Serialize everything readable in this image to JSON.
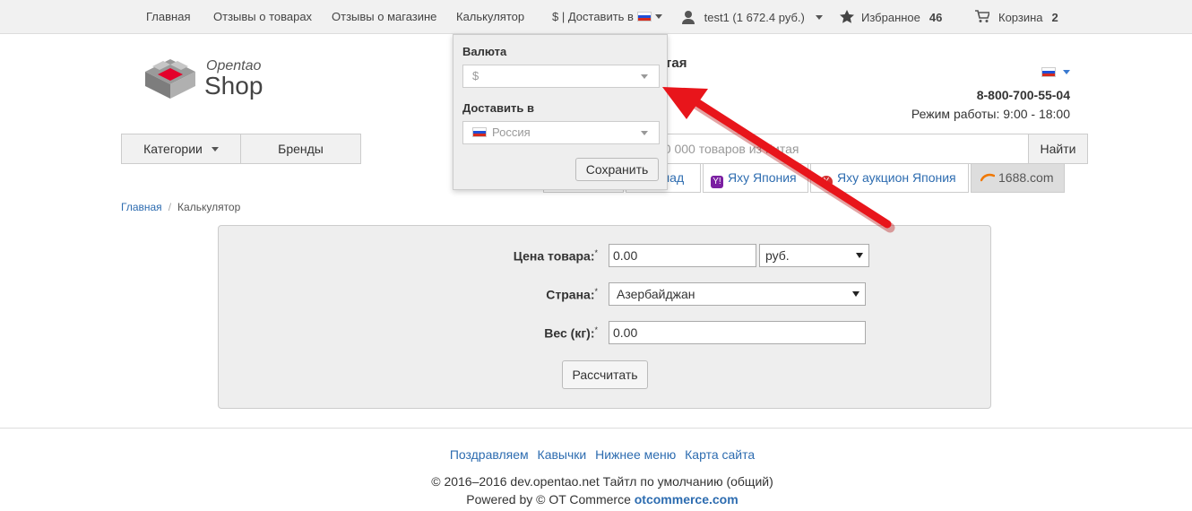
{
  "topbar": {
    "home": "Главная",
    "product_reviews": "Отзывы о товарах",
    "shop_reviews": "Отзывы о магазине",
    "calculator": "Калькулятор",
    "currency_delivery": "$ | Доставить в",
    "user": "test1 (1 672.4 руб.)",
    "favorites_label": "Избранное",
    "favorites_count": "46",
    "cart_label": "Корзина",
    "cart_count": "2"
  },
  "header": {
    "logo_top": "Opentao",
    "logo_bottom": "Shop",
    "title_fragment": "тая",
    "phone": "8-800-700-55-04",
    "hours": "Режим работы: 9:00 - 18:00"
  },
  "nav": {
    "categories": "Категории",
    "brands": "Бренды",
    "search_placeholder": "00 000 товаров из Китая",
    "search_button": "Найти"
  },
  "tabs": [
    {
      "label": "лад"
    },
    {
      "label": "Яху Япония",
      "icon": "Y!"
    },
    {
      "label": "Яху аукцион Япония",
      "icon": "Y"
    },
    {
      "label": "1688.com"
    }
  ],
  "breadcrumb": {
    "home": "Главная",
    "sep": "/",
    "current": "Калькулятор"
  },
  "calculator": {
    "price_label": "Цена товара:",
    "price_value": "0.00",
    "price_currency": "руб.",
    "country_label": "Страна:",
    "country_value": "Азербайджан",
    "weight_label": "Вес (кг):",
    "weight_value": "0.00",
    "required_mark": "*",
    "calc_button": "Рассчитать"
  },
  "popup": {
    "currency_label": "Валюта",
    "currency_value": "$",
    "deliver_label": "Доставить в",
    "deliver_value": "Россия",
    "save_button": "Сохранить"
  },
  "footer": {
    "links": [
      "Поздравляем",
      "Кавычки",
      "Нижнее меню",
      "Карта сайта"
    ],
    "copyright": "© 2016–2016 dev.opentao.net Тайтл по умолчанию (общий)",
    "powered_prefix": "Powered by © OT Commerce",
    "powered_link": "otcommerce.com"
  },
  "colors": {
    "link": "#2d6cb0",
    "arrow": "#e8151b",
    "panel": "#eeeeee"
  }
}
